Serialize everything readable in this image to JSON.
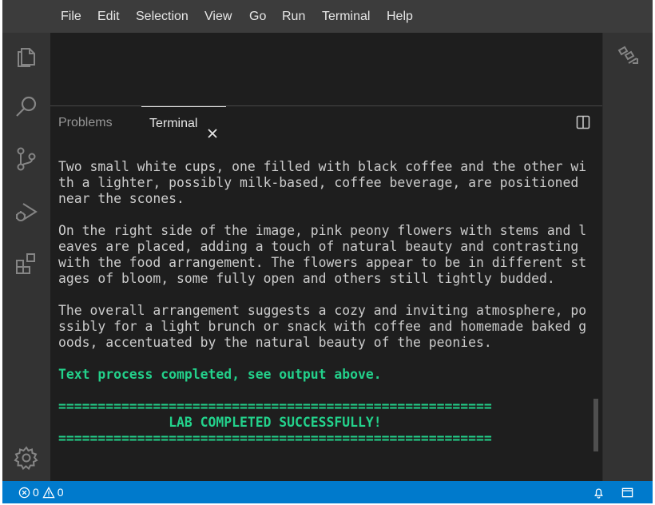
{
  "menu": {
    "items": [
      "File",
      "Edit",
      "Selection",
      "View",
      "Go",
      "Run",
      "Terminal",
      "Help"
    ]
  },
  "activitybar": {
    "icons": [
      "explorer-icon",
      "search-icon",
      "source-control-icon",
      "run-debug-icon",
      "extensions-icon",
      "settings-gear-icon"
    ]
  },
  "panel": {
    "tabs": {
      "problems": "Problems",
      "terminal": "Terminal"
    }
  },
  "terminal": {
    "lines": [
      {
        "text": "Two small white cups, one filled with black coffee and the other wi",
        "style": "normal"
      },
      {
        "text": "th a lighter, possibly milk-based, coffee beverage, are positioned",
        "style": "normal"
      },
      {
        "text": "near the scones.",
        "style": "normal"
      },
      {
        "text": "",
        "style": "normal"
      },
      {
        "text": "On the right side of the image, pink peony flowers with stems and l",
        "style": "normal"
      },
      {
        "text": "eaves are placed, adding a touch of natural beauty and contrasting",
        "style": "normal"
      },
      {
        "text": "with the food arrangement. The flowers appear to be in different st",
        "style": "normal"
      },
      {
        "text": "ages of bloom, some fully open and others still tightly budded.",
        "style": "normal"
      },
      {
        "text": "",
        "style": "normal"
      },
      {
        "text": "The overall arrangement suggests a cozy and inviting atmosphere, po",
        "style": "normal"
      },
      {
        "text": "ssibly for a light brunch or snack with coffee and homemade baked g",
        "style": "normal"
      },
      {
        "text": "oods, accentuated by the natural beauty of the peonies.",
        "style": "normal"
      },
      {
        "text": "",
        "style": "normal"
      },
      {
        "text": "Text process completed, see output above.",
        "style": "green"
      },
      {
        "text": "",
        "style": "normal"
      },
      {
        "text": "=======================================================",
        "style": "green"
      },
      {
        "text": "              LAB COMPLETED SUCCESSFULLY!",
        "style": "green"
      },
      {
        "text": "=======================================================",
        "style": "green"
      }
    ]
  },
  "statusbar": {
    "errors": "0",
    "warnings": "0"
  },
  "colors": {
    "accent": "#007acc",
    "terminal_green": "#23d18b",
    "background": "#1e1e1e"
  }
}
